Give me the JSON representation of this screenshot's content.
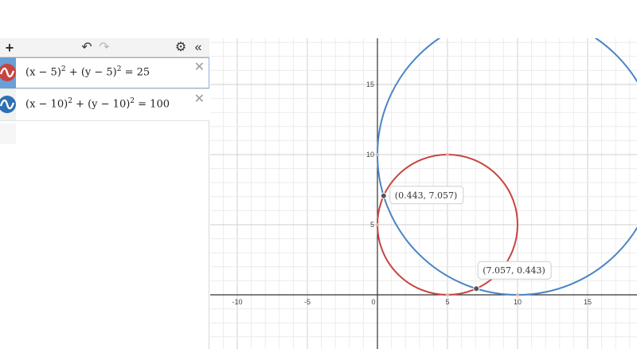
{
  "toolbar": {
    "add_label": "+",
    "undo_label": "↶",
    "redo_label": "↷",
    "settings_label": "⚙",
    "collapse_label": "«"
  },
  "expressions": [
    {
      "lhs1": "(x − 5)",
      "exp1": "2",
      "plus": " + ",
      "lhs2": "(y − 5)",
      "exp2": "2",
      "rhs": " = 25",
      "color": "#c74440",
      "icon": "wave-icon",
      "close": "✕"
    },
    {
      "lhs1": "(x − 10)",
      "exp1": "2",
      "plus": " + ",
      "lhs2": "(y − 10)",
      "exp2": "2",
      "rhs": " = 100",
      "color": "#2d70b3",
      "icon": "wave-icon",
      "close": "✕"
    }
  ],
  "graph": {
    "x_ticks": [
      "-10",
      "-5",
      "0",
      "5",
      "10",
      "15"
    ],
    "y_ticks": [
      "5",
      "10",
      "15"
    ],
    "circles": [
      {
        "h": 5,
        "k": 5,
        "r": 5,
        "color": "#c74440"
      },
      {
        "h": 10,
        "k": 10,
        "r": 10,
        "color": "#4a84c4"
      }
    ],
    "intersections": [
      {
        "x": 0.443,
        "y": 7.057,
        "label": "(0.443, 7.057)"
      },
      {
        "x": 7.057,
        "y": 0.443,
        "label": "(7.057, 0.443)"
      }
    ]
  }
}
